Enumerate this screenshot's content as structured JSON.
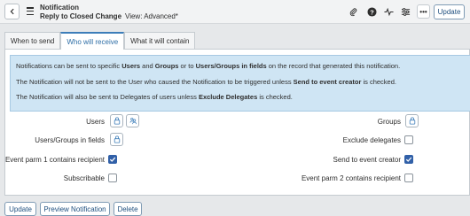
{
  "header": {
    "title": "Notification",
    "subtitle": "Reply to Closed Change",
    "view_label": "View: Advanced*",
    "update_label": "Update",
    "more_label": "•••"
  },
  "tabs": [
    {
      "label": "When to send",
      "active": false
    },
    {
      "label": "Who will receive",
      "active": true
    },
    {
      "label": "What it will contain",
      "active": false
    }
  ],
  "info": {
    "line1_a": "Notifications can be sent to specific ",
    "line1_b": "Users",
    "line1_c": " and ",
    "line1_d": "Groups",
    "line1_e": " or to ",
    "line1_f": "Users/Groups in fields",
    "line1_g": " on the record that generated this notification.",
    "line2_a": "The Notification will not be sent to the User who caused the Notification to be triggered unless ",
    "line2_b": "Send to event creator",
    "line2_c": " is checked.",
    "line3_a": "The Notification will also be sent to Delegates of users unless ",
    "line3_b": "Exclude Delegates",
    "line3_c": " is checked."
  },
  "fields": {
    "users": "Users",
    "groups": "Groups",
    "users_groups_in_fields": "Users/Groups in fields",
    "exclude_delegates": {
      "label": "Exclude delegates",
      "checked": false
    },
    "event_parm1": {
      "label": "Event parm 1 contains recipient",
      "checked": true
    },
    "send_to_event_creator": {
      "label": "Send to event creator",
      "checked": true
    },
    "subscribable": {
      "label": "Subscribable",
      "checked": false
    },
    "event_parm2": {
      "label": "Event parm 2 contains recipient",
      "checked": false
    }
  },
  "buttons": {
    "update": "Update",
    "preview": "Preview Notification",
    "delete": "Delete"
  },
  "colors": {
    "accent": "#3c7db9",
    "info_bg": "#cfe5f4",
    "checkbox_checked": "#3160a8"
  }
}
